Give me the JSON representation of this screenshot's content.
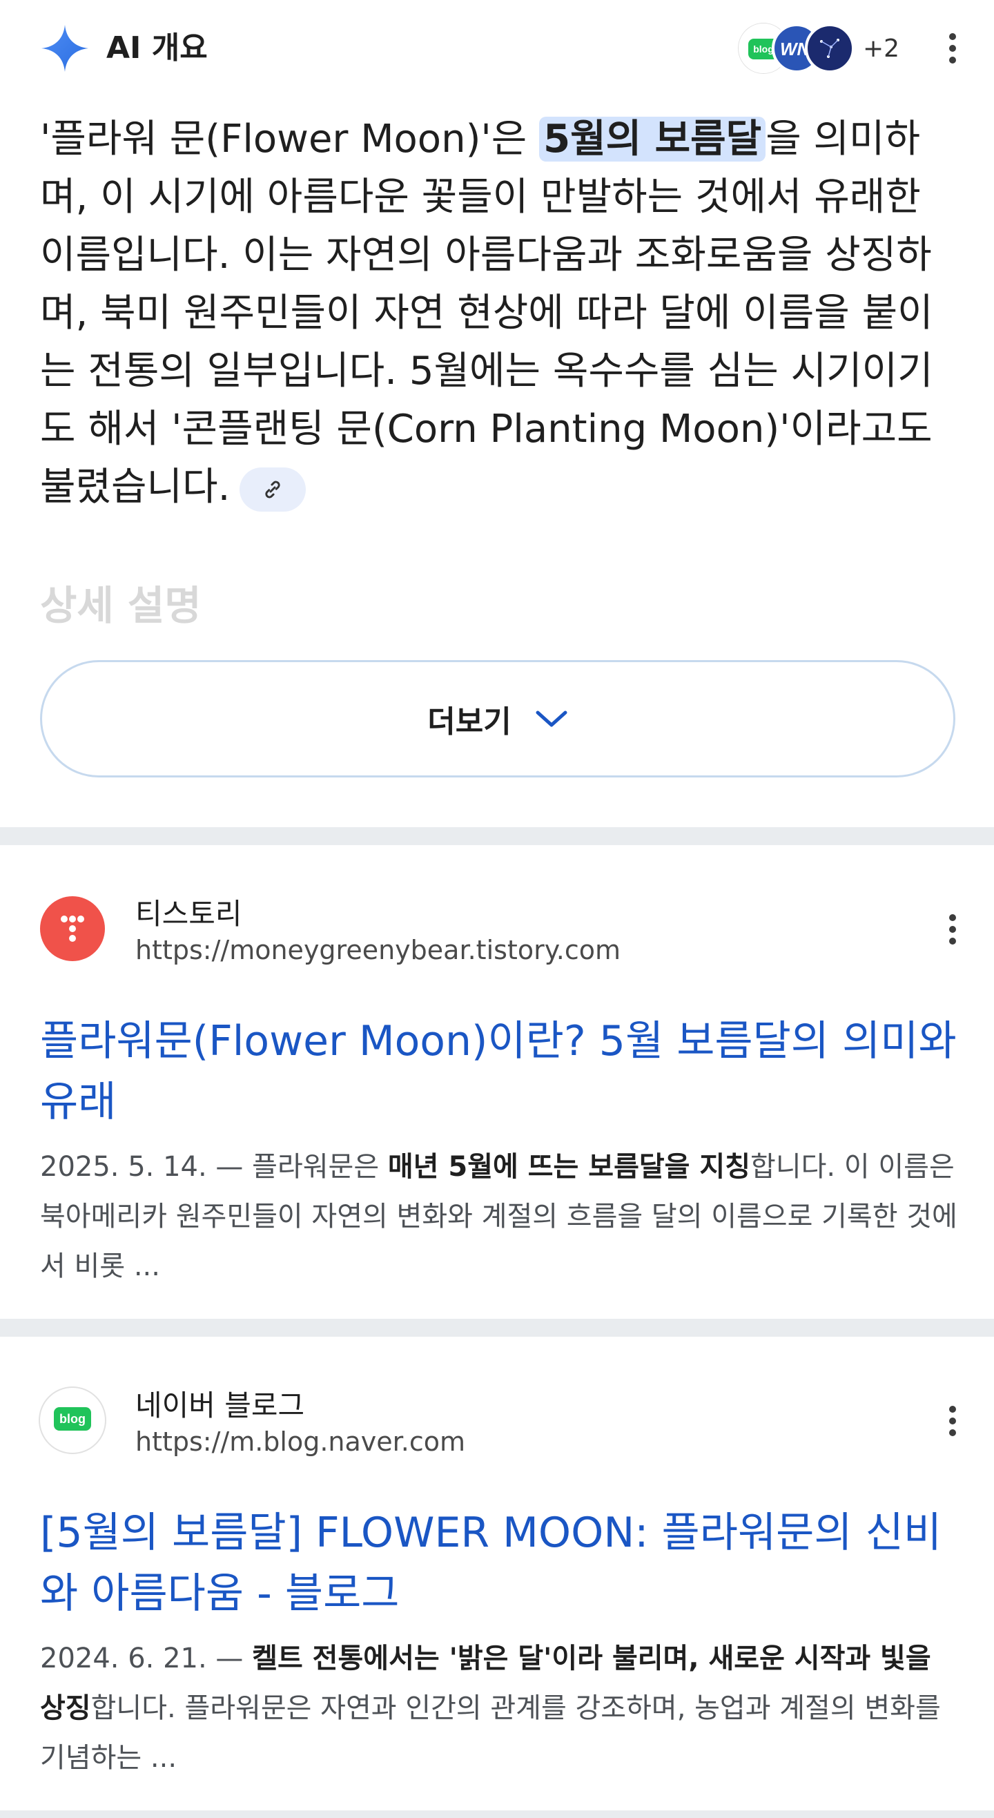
{
  "ai_overview": {
    "title": "AI 개요",
    "sources_more": "+2",
    "source_badges": [
      "blog",
      "WN"
    ],
    "body_before": "'플라워 문(Flower Moon)'은 ",
    "body_highlight": "5월의 보름달",
    "body_after": "을 의미하며, 이 시기에 아름다운 꽃들이 만발하는 것에서 유래한 이름입니다. 이는 자연의 아름다움과 조화로움을 상징하며, 북미 원주민들이 자연 현상에 따라 달에 이름을 붙이는 전통의 일부입니다. 5월에는 옥수수를 심는 시기이기도 해서 '콘플랜팅 문(Corn Planting Moon)'이라고도 불렸습니다.",
    "faded_heading": "상세 설명",
    "more_button": "더보기"
  },
  "results": [
    {
      "site_name": "티스토리",
      "url": "https://moneygreenybear.tistory.com",
      "title": "플라워문(Flower Moon)이란? 5월 보름달의 의미와 유래",
      "date": "2025. 5. 14. — ",
      "snippet_a": "플라워문은 ",
      "snippet_b": "매년 5월에 뜨는 보름달을 지칭",
      "snippet_c": "합니다. 이 이름은 북아메리카 원주민들이 자연의 변화와 계절의 흐름을 달의 이름으로 기록한 것에서 비롯 ..."
    },
    {
      "site_name": "네이버 블로그",
      "url": "https://m.blog.naver.com",
      "badge": "blog",
      "title": "[5월의 보름달] FLOWER MOON: 플라워문의 신비와 아름다움 - 블로그",
      "date": "2024. 6. 21. — ",
      "snippet_a": "",
      "snippet_b": "켈트 전통에서는 '밝은 달'이라 불리며, 새로운 시작과 빛을 상징",
      "snippet_c": "합니다. 플라워문은 자연과 인간의 관계를 강조하며, 농업과 계절의 변화를 기념하는 ..."
    }
  ],
  "colors": {
    "link": "#1a56c4",
    "highlight": "#d3e3fd",
    "tistory": "#f0524a",
    "naver_green": "#20c35a",
    "separator": "#e9ecef"
  }
}
